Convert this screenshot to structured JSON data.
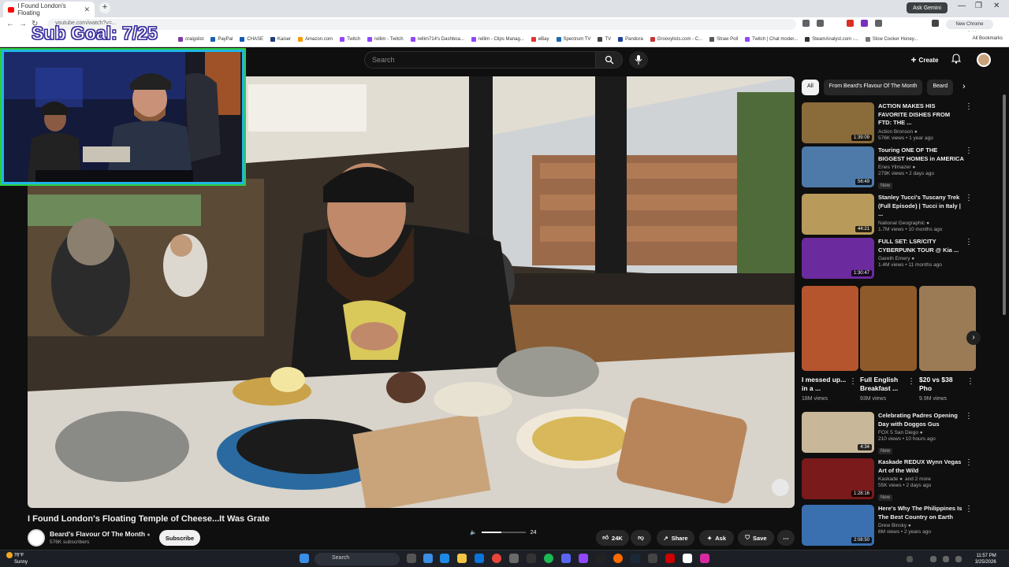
{
  "browser": {
    "tab_title": "I Found London's Floating",
    "url": "youtube.com/watch?v=...",
    "gemini_label": "Ask Gemini",
    "new_chrome_label": "New Chrome available",
    "all_bookmarks": "All Bookmarks",
    "bookmarks": [
      "craigslist",
      "PayPal",
      "CHASE",
      "Kaiser",
      "Amazon.com",
      "Twitch",
      "rellim - Twitch",
      "rellim714's Dashboa...",
      "rellim - Clips Manag...",
      "eBay",
      "Spectrum TV",
      "TV",
      "Pandora",
      "Groovylists.com - C...",
      "Straw Poll",
      "Twitch | Chat moder...",
      "SteamAnalyst.com -...",
      "Slow Cooker Honey..."
    ]
  },
  "overlay": {
    "sub_goal": "Sub Goal: 7/25"
  },
  "youtube": {
    "search_placeholder": "Search",
    "create_label": "Create",
    "video_title": "I Found London's Floating Temple of Cheese...It Was Grate",
    "channel_name": "Beard's Flavour Of The Month",
    "channel_subs": "576K subscribers",
    "subscribe_label": "Subscribe",
    "volume_value": "24",
    "volume_level": 0.45,
    "like_count": "24K",
    "share_label": "Share",
    "ask_label": "Ask",
    "save_label": "Save"
  },
  "chips": [
    "All",
    "From Beard's Flavour Of The Month",
    "Beard"
  ],
  "recommendations": [
    {
      "title": "ACTION MAKES HIS FAVORITE DISHES FROM FTD: THE ...",
      "channel": "Action Bronson",
      "meta": "576K views • 1 year ago",
      "duration": "1:39:09",
      "color": "#8a6b3a"
    },
    {
      "title": "Touring ONE OF THE BIGGEST HOMES in AMERICA",
      "channel": "Enes Yilmazer",
      "meta": "279K views • 2 days ago",
      "duration": "56:49",
      "badge": "New",
      "color": "#4d7aa8"
    },
    {
      "title": "Stanley Tucci's Tuscany Trek (Full Episode) | Tucci in Italy | ...",
      "channel": "National Geographic",
      "meta": "1.7M views • 10 months ago",
      "duration": "44:21",
      "color": "#b89a5a"
    },
    {
      "title": "FULL SET: LSR/CITY CYBERPUNK TOUR @ Kia ...",
      "channel": "Gareth Emery",
      "meta": "1.4M views • 11 months ago",
      "duration": "1:30:47",
      "color": "#6b2a9e"
    }
  ],
  "shorts": [
    {
      "title": "I messed up... in a ...",
      "views": "18M views",
      "color": "#b5552e"
    },
    {
      "title": "Full English Breakfast ...",
      "views": "93M views",
      "color": "#8e5a2a"
    },
    {
      "title": "$20 vs $38 Pho",
      "views": "9.9M views",
      "color": "#9a7b55"
    }
  ],
  "recommendations2": [
    {
      "title": "Celebrating Padres Opening Day with Doggos Gus",
      "channel": "FOX 5 San Diego",
      "meta": "210 views • 10 hours ago",
      "duration": "4:34",
      "badge": "New",
      "color": "#c9b79a"
    },
    {
      "title": "Kaskade REDUX Wynn Vegas Art of the Wild",
      "channel": "Kaskade",
      "channel_extra": "and 2 more",
      "meta": "55K views • 2 days ago",
      "duration": "1:28:16",
      "badge": "New",
      "color": "#7a1a1a"
    },
    {
      "title": "Here's Why The Philippines Is The Best Country on Earth",
      "channel": "Drew Binsky",
      "meta": "6M views • 2 years ago",
      "duration": "2:08:50",
      "color": "#3a6fb0"
    }
  ],
  "taskbar": {
    "temp": "76°F",
    "weather": "Sunny",
    "search": "Search",
    "time": "11:57 PM",
    "date": "3/25/2026"
  }
}
